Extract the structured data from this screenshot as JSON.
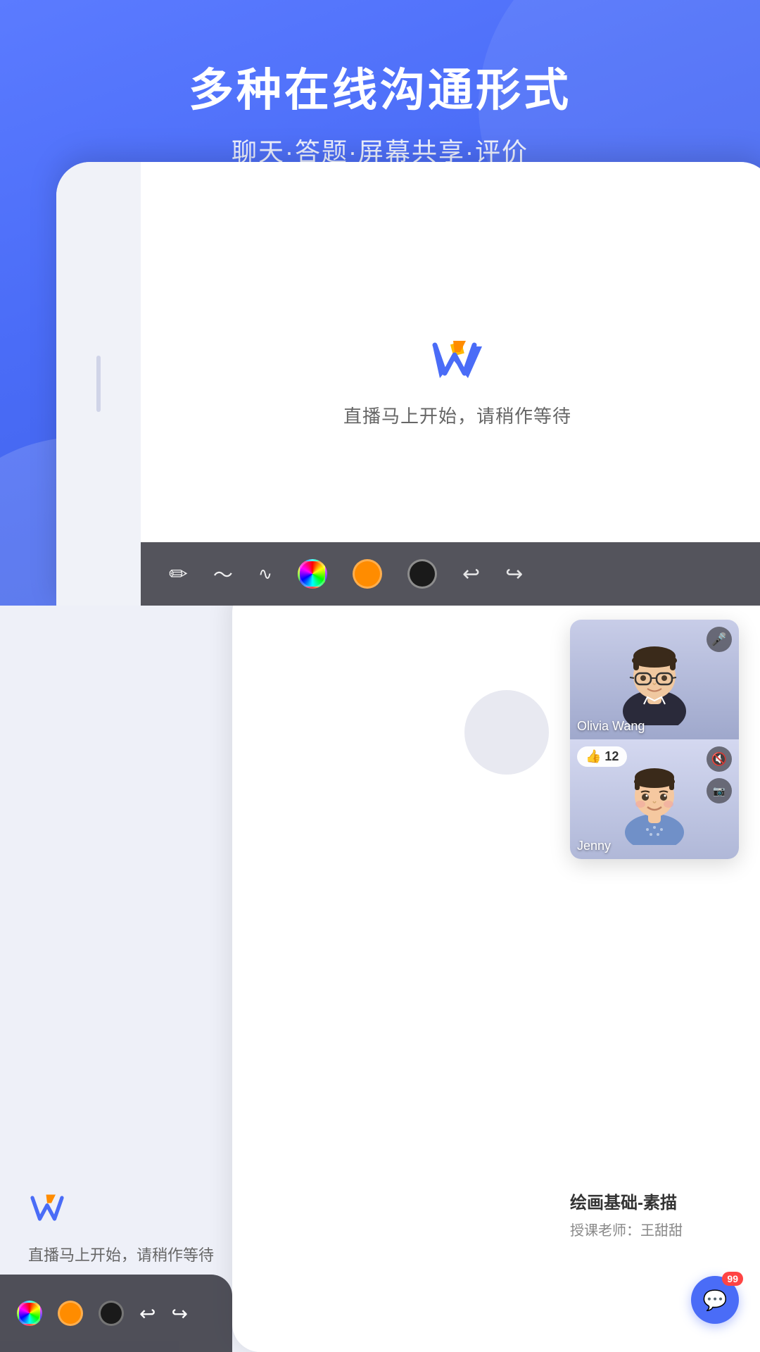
{
  "header": {
    "title": "多种在线沟通形式",
    "subtitle": "聊天·答题·屏幕共享·评价"
  },
  "tablet": {
    "waiting_text": "直播马上开始，请稍作等待",
    "logo_alt": "W logo"
  },
  "toolbar": {
    "colors": [
      "rainbow",
      "orange",
      "black"
    ],
    "actions": [
      "undo",
      "redo"
    ]
  },
  "video_panels": [
    {
      "name": "Olivia Wang",
      "role": "teacher",
      "mic_on": true
    },
    {
      "name": "Jenny",
      "role": "student",
      "mic_on": false,
      "cam_on": false,
      "likes": 12
    }
  ],
  "course": {
    "title": "绘画基础-素描",
    "teacher_label": "授课老师：",
    "teacher_name": "王甜甜"
  },
  "chat": {
    "badge_count": "99"
  }
}
